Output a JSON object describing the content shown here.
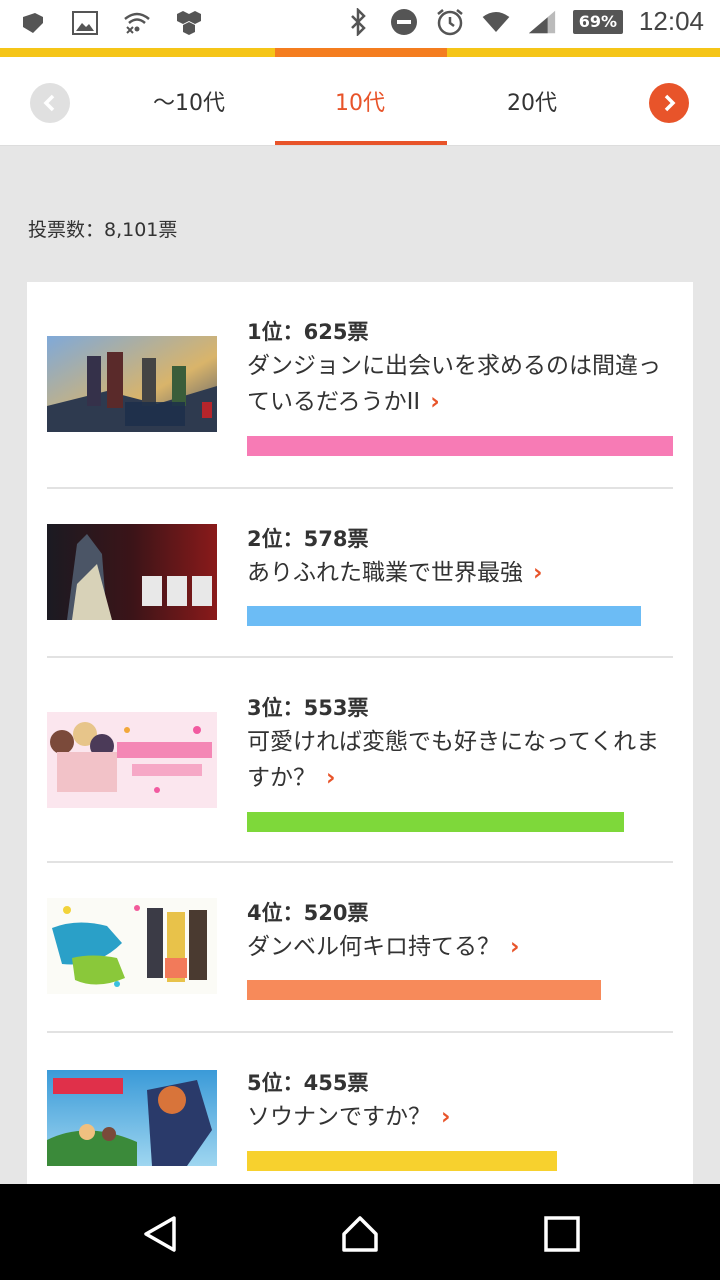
{
  "status": {
    "battery": "69%",
    "time": "12:04",
    "icons": [
      "cast-icon",
      "image-icon",
      "wifi-off-icon",
      "hex-icon",
      "bluetooth-icon",
      "dnd-icon",
      "alarm-icon",
      "wifi-icon",
      "signal-icon",
      "battery-icon"
    ]
  },
  "tabs": {
    "items": [
      "〜10代",
      "10代",
      "20代"
    ],
    "active_index": 1,
    "prev_icon": "chevron-left-icon",
    "next_icon": "chevron-right-icon"
  },
  "vote_count": "投票数：8,101票",
  "ranking": [
    {
      "rank": "1位：625票",
      "title": "ダンジョンに出会いを求めるのは間違っているだろうかII",
      "color": "#f77bb5",
      "fraction": 1.0
    },
    {
      "rank": "2位：578票",
      "title": "ありふれた職業で世界最強",
      "color": "#6cbcf5",
      "fraction": 0.925
    },
    {
      "rank": "3位：553票",
      "title": "可愛ければ変態でも好きになってくれますか？",
      "color": "#7ed83a",
      "fraction": 0.885
    },
    {
      "rank": "4位：520票",
      "title": "ダンベル何キロ持てる？",
      "color": "#f78a5a",
      "fraction": 0.832
    },
    {
      "rank": "5位：455票",
      "title": "ソウナンですか？",
      "color": "#f7d12e",
      "fraction": 0.728
    }
  ],
  "nav": {
    "back": "back-icon",
    "home": "home-icon",
    "recents": "recents-icon"
  }
}
